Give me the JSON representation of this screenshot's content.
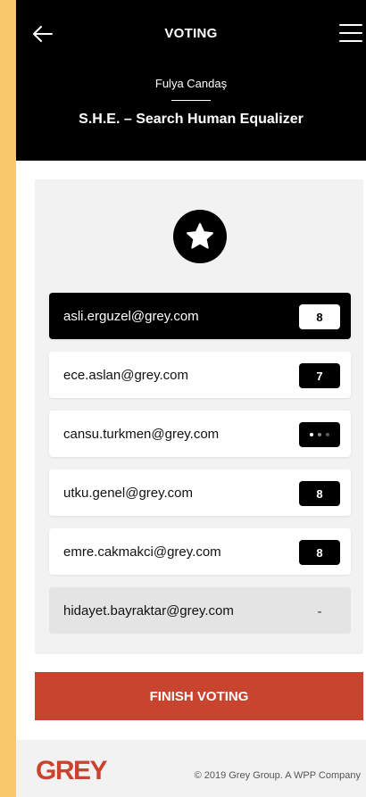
{
  "header": {
    "title": "VOTING",
    "user_name": "Fulya Candaş",
    "project_name": "S.H.E. – Search Human Equalizer"
  },
  "votes": [
    {
      "email": "asli.erguzel@grey.com",
      "score": "8",
      "state": "selected"
    },
    {
      "email": "ece.aslan@grey.com",
      "score": "7",
      "state": "voted"
    },
    {
      "email": "cansu.turkmen@grey.com",
      "score": "",
      "state": "pending"
    },
    {
      "email": "utku.genel@grey.com",
      "score": "8",
      "state": "voted"
    },
    {
      "email": "emre.cakmakci@grey.com",
      "score": "8",
      "state": "voted"
    },
    {
      "email": "hidayet.bayraktar@grey.com",
      "score": "-",
      "state": "disabled"
    }
  ],
  "finish_button": "FINISH VOTING",
  "footer": {
    "logo": "GREY",
    "copyright": "© 2019 Grey Group. A WPP Company"
  },
  "colors": {
    "page_background": "#f9c86c",
    "header_background": "#000000",
    "accent": "#c8442e"
  },
  "icons": {
    "back": "arrow-left-icon",
    "menu": "hamburger-menu-icon",
    "badge": "star-icon",
    "pending": "loading-dots-icon"
  }
}
